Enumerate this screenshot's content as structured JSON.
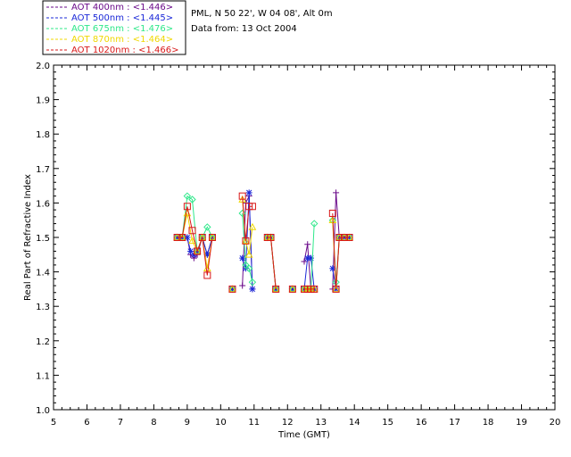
{
  "info": {
    "site": "PML, N 50 22', W 04 08', Alt 0m",
    "date": "Data from: 13 Oct 2004"
  },
  "chart_data": {
    "type": "line",
    "xlabel": "Time (GMT)",
    "ylabel": "Real Part of Refractive Index",
    "xlim": [
      5,
      20
    ],
    "ylim": [
      1.0,
      2.0
    ],
    "xticks": [
      "5",
      "6",
      "7",
      "8",
      "9",
      "10",
      "11",
      "12",
      "13",
      "14",
      "15",
      "16",
      "17",
      "18",
      "19",
      "20"
    ],
    "yticks": [
      "1.0",
      "1.1",
      "1.2",
      "1.3",
      "1.4",
      "1.5",
      "1.6",
      "1.7",
      "1.8",
      "1.9",
      "2.0"
    ],
    "grid": false,
    "legend_position": "top-left",
    "series": [
      {
        "name": "AOT  400nm : <1.446>",
        "color": "#6a0a8a",
        "marker": "plus",
        "segments": [
          [
            [
              8.7,
              1.5
            ],
            [
              8.85,
              1.5
            ],
            [
              9.0,
              1.5
            ],
            [
              9.1,
              1.45
            ],
            [
              9.2,
              1.44
            ],
            [
              9.3,
              1.45
            ],
            [
              9.45,
              1.5
            ],
            [
              9.6,
              1.45
            ],
            [
              9.75,
              1.5
            ]
          ],
          [
            [
              10.35,
              1.35
            ]
          ],
          [
            [
              10.65,
              1.36
            ],
            [
              10.75,
              1.6
            ],
            [
              10.85,
              1.62
            ],
            [
              10.95,
              1.35
            ]
          ],
          [
            [
              11.4,
              1.5
            ],
            [
              11.5,
              1.5
            ],
            [
              11.65,
              1.35
            ]
          ],
          [
            [
              12.15,
              1.35
            ]
          ],
          [
            [
              12.5,
              1.43
            ],
            [
              12.6,
              1.48
            ],
            [
              12.7,
              1.35
            ],
            [
              12.8,
              1.35
            ]
          ],
          [
            [
              13.35,
              1.35
            ],
            [
              13.45,
              1.63
            ],
            [
              13.55,
              1.5
            ],
            [
              13.7,
              1.5
            ],
            [
              13.85,
              1.5
            ]
          ]
        ]
      },
      {
        "name": "AOT  500nm : <1.445>",
        "color": "#1a28d8",
        "marker": "star",
        "segments": [
          [
            [
              8.7,
              1.5
            ],
            [
              8.85,
              1.5
            ],
            [
              9.0,
              1.5
            ],
            [
              9.1,
              1.46
            ],
            [
              9.2,
              1.45
            ],
            [
              9.3,
              1.46
            ],
            [
              9.45,
              1.5
            ],
            [
              9.6,
              1.45
            ],
            [
              9.75,
              1.5
            ]
          ],
          [
            [
              10.35,
              1.35
            ]
          ],
          [
            [
              10.65,
              1.44
            ],
            [
              10.75,
              1.41
            ],
            [
              10.85,
              1.63
            ],
            [
              10.95,
              1.35
            ]
          ],
          [
            [
              11.4,
              1.5
            ],
            [
              11.5,
              1.5
            ],
            [
              11.65,
              1.35
            ]
          ],
          [
            [
              12.15,
              1.35
            ]
          ],
          [
            [
              12.5,
              1.35
            ],
            [
              12.6,
              1.44
            ],
            [
              12.7,
              1.44
            ],
            [
              12.8,
              1.35
            ]
          ],
          [
            [
              13.35,
              1.41
            ],
            [
              13.45,
              1.35
            ],
            [
              13.55,
              1.5
            ],
            [
              13.7,
              1.5
            ],
            [
              13.85,
              1.5
            ]
          ]
        ]
      },
      {
        "name": "AOT  675nm : <1.476>",
        "color": "#2ee88a",
        "marker": "diamond",
        "segments": [
          [
            [
              8.7,
              1.5
            ],
            [
              8.85,
              1.5
            ],
            [
              9.0,
              1.62
            ],
            [
              9.15,
              1.61
            ],
            [
              9.3,
              1.46
            ],
            [
              9.45,
              1.5
            ],
            [
              9.6,
              1.53
            ],
            [
              9.75,
              1.5
            ]
          ],
          [
            [
              10.35,
              1.35
            ]
          ],
          [
            [
              10.65,
              1.57
            ],
            [
              10.75,
              1.42
            ],
            [
              10.85,
              1.41
            ],
            [
              10.95,
              1.37
            ]
          ],
          [
            [
              11.4,
              1.5
            ],
            [
              11.5,
              1.5
            ],
            [
              11.65,
              1.35
            ]
          ],
          [
            [
              12.15,
              1.35
            ]
          ],
          [
            [
              12.5,
              1.35
            ],
            [
              12.6,
              1.35
            ],
            [
              12.7,
              1.35
            ],
            [
              12.8,
              1.54
            ]
          ],
          [
            [
              13.35,
              1.55
            ],
            [
              13.45,
              1.37
            ],
            [
              13.55,
              1.5
            ],
            [
              13.7,
              1.5
            ],
            [
              13.85,
              1.5
            ]
          ]
        ]
      },
      {
        "name": "AOT  870nm : <1.464>",
        "color": "#f0d800",
        "marker": "triangle",
        "segments": [
          [
            [
              8.7,
              1.5
            ],
            [
              8.85,
              1.5
            ],
            [
              9.0,
              1.57
            ],
            [
              9.15,
              1.49
            ],
            [
              9.3,
              1.46
            ],
            [
              9.45,
              1.5
            ],
            [
              9.6,
              1.41
            ],
            [
              9.75,
              1.5
            ]
          ],
          [
            [
              10.35,
              1.35
            ]
          ],
          [
            [
              10.65,
              1.61
            ],
            [
              10.75,
              1.49
            ],
            [
              10.85,
              1.45
            ],
            [
              10.95,
              1.53
            ]
          ],
          [
            [
              11.4,
              1.5
            ],
            [
              11.5,
              1.5
            ],
            [
              11.65,
              1.35
            ]
          ],
          [
            [
              12.15,
              1.35
            ]
          ],
          [
            [
              12.5,
              1.35
            ],
            [
              12.6,
              1.35
            ],
            [
              12.7,
              1.35
            ],
            [
              12.8,
              1.35
            ]
          ],
          [
            [
              13.35,
              1.55
            ],
            [
              13.45,
              1.35
            ],
            [
              13.55,
              1.5
            ],
            [
              13.7,
              1.5
            ],
            [
              13.85,
              1.5
            ]
          ]
        ]
      },
      {
        "name": "AOT 1020nm : <1.466>",
        "color": "#d81818",
        "marker": "square",
        "segments": [
          [
            [
              8.7,
              1.5
            ],
            [
              8.85,
              1.5
            ],
            [
              9.0,
              1.59
            ],
            [
              9.15,
              1.52
            ],
            [
              9.3,
              1.46
            ],
            [
              9.45,
              1.5
            ],
            [
              9.6,
              1.39
            ],
            [
              9.75,
              1.5
            ]
          ],
          [
            [
              10.35,
              1.35
            ]
          ],
          [
            [
              10.65,
              1.62
            ],
            [
              10.75,
              1.49
            ],
            [
              10.85,
              1.59
            ],
            [
              10.95,
              1.59
            ]
          ],
          [
            [
              11.4,
              1.5
            ],
            [
              11.5,
              1.5
            ],
            [
              11.65,
              1.35
            ]
          ],
          [
            [
              12.15,
              1.35
            ]
          ],
          [
            [
              12.5,
              1.35
            ],
            [
              12.6,
              1.35
            ],
            [
              12.7,
              1.35
            ],
            [
              12.8,
              1.35
            ]
          ],
          [
            [
              13.35,
              1.57
            ],
            [
              13.45,
              1.35
            ],
            [
              13.55,
              1.5
            ],
            [
              13.7,
              1.5
            ],
            [
              13.85,
              1.5
            ]
          ]
        ]
      }
    ]
  }
}
